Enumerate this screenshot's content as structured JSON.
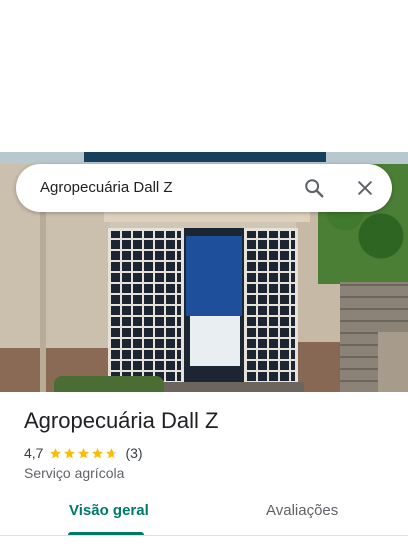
{
  "search": {
    "query": "Agropecuária Dall Z",
    "search_icon": "search-icon",
    "close_icon": "close-icon"
  },
  "place": {
    "name": "Agropecuária Dall Z",
    "rating": "4,7",
    "rating_value": 4.7,
    "stars_max": 5,
    "review_count": "(3)",
    "category": "Serviço agrícola"
  },
  "tabs": [
    {
      "label": "Visão geral",
      "active": true
    },
    {
      "label": "Avaliações",
      "active": false
    }
  ],
  "colors": {
    "accent": "#00796b",
    "star": "#fbbc04",
    "text_primary": "#202124",
    "text_secondary": "#5f6368"
  }
}
